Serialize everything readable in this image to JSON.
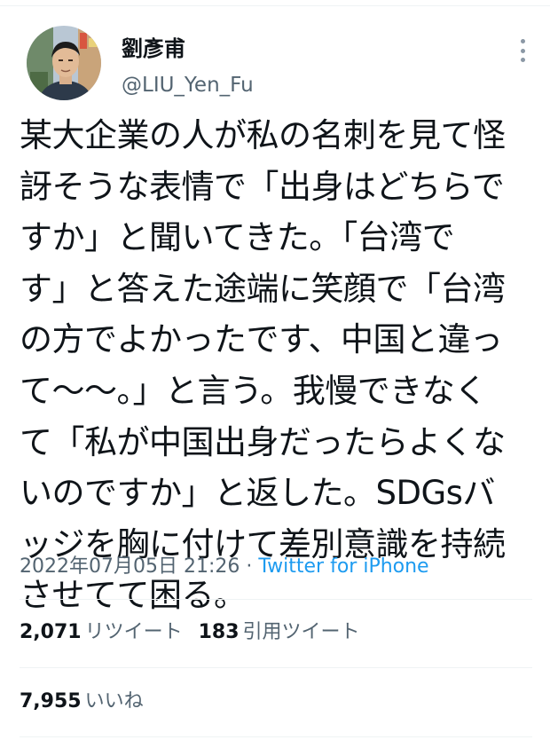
{
  "author": {
    "display_name": "劉彥甫",
    "handle": "@LIU_Yen_Fu"
  },
  "tweet": {
    "text": "某大企業の人が私の名刺を見て怪\n訝そうな表情で「出身はどちらで\nすか」と聞いてきた。「台湾で\nす」と答えた途端に笑顔で「台湾\nの方でよかったです、中国と違っ\nて〜〜。」と言う。我慢できなく\nて「私が中国出身だったらよくな\nいのですか」と返した。SDGsバ\nッジを胸に付けて差別意識を持続\nさせてて困る。",
    "timestamp": "2022年07月05日 21:26",
    "separator": " · ",
    "source": "Twitter for iPhone"
  },
  "stats": {
    "retweets": {
      "count": "2,071",
      "label": "リツイート"
    },
    "quotes": {
      "count": "183",
      "label": "引用ツイート"
    },
    "likes": {
      "count": "7,955",
      "label": "いいね"
    }
  },
  "colors": {
    "text_primary": "#0f1419",
    "text_secondary": "#536471",
    "link_blue": "#1d9bf0",
    "divider": "#eff3f4"
  },
  "icons": {
    "more": "more-vertical-icon"
  }
}
